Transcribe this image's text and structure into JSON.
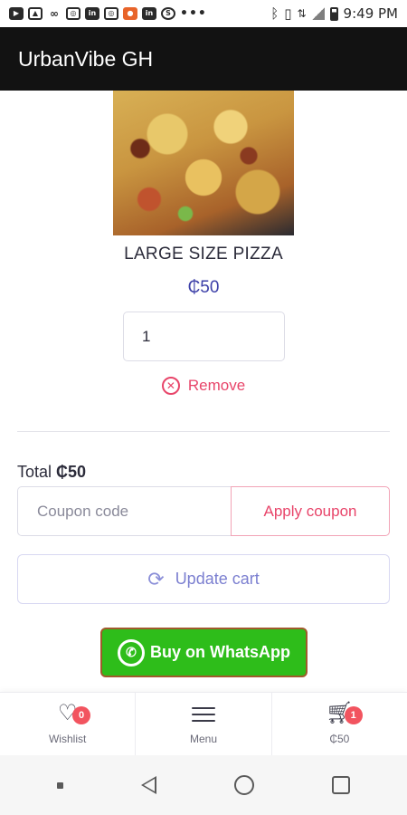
{
  "status_bar": {
    "time": "9:49 PM",
    "left_icons": [
      "youtube-icon",
      "gallery-icon",
      "voicemail-icon",
      "instagram-icon",
      "linkedin-icon",
      "instagram-icon",
      "app-icon",
      "linkedin-icon",
      "shazam-icon",
      "more-dots-icon"
    ],
    "right_icons": [
      "bluetooth-icon",
      "vibrate-icon",
      "data-icon",
      "signal-icon",
      "battery-icon"
    ]
  },
  "app_bar": {
    "title": "UrbanVibe GH"
  },
  "product": {
    "name": "LARGE SIZE PIZZA",
    "price": "₵50",
    "quantity": "1",
    "remove_label": "Remove"
  },
  "cart": {
    "total_label": "Total",
    "total_value": "₵50",
    "coupon_placeholder": "Coupon code",
    "apply_label": "Apply coupon",
    "update_label": "Update cart",
    "whatsapp_label": "Buy on WhatsApp"
  },
  "bottom_nav": {
    "wishlist": {
      "label": "Wishlist",
      "badge": "0"
    },
    "menu": {
      "label": "Menu"
    },
    "cart": {
      "label": "₵50",
      "badge": "1"
    }
  },
  "colors": {
    "accent": "#e8456a",
    "price": "#3c3fa8",
    "whatsapp": "#2ebd1a",
    "badge": "#f2545f",
    "app_bar": "#121212"
  }
}
